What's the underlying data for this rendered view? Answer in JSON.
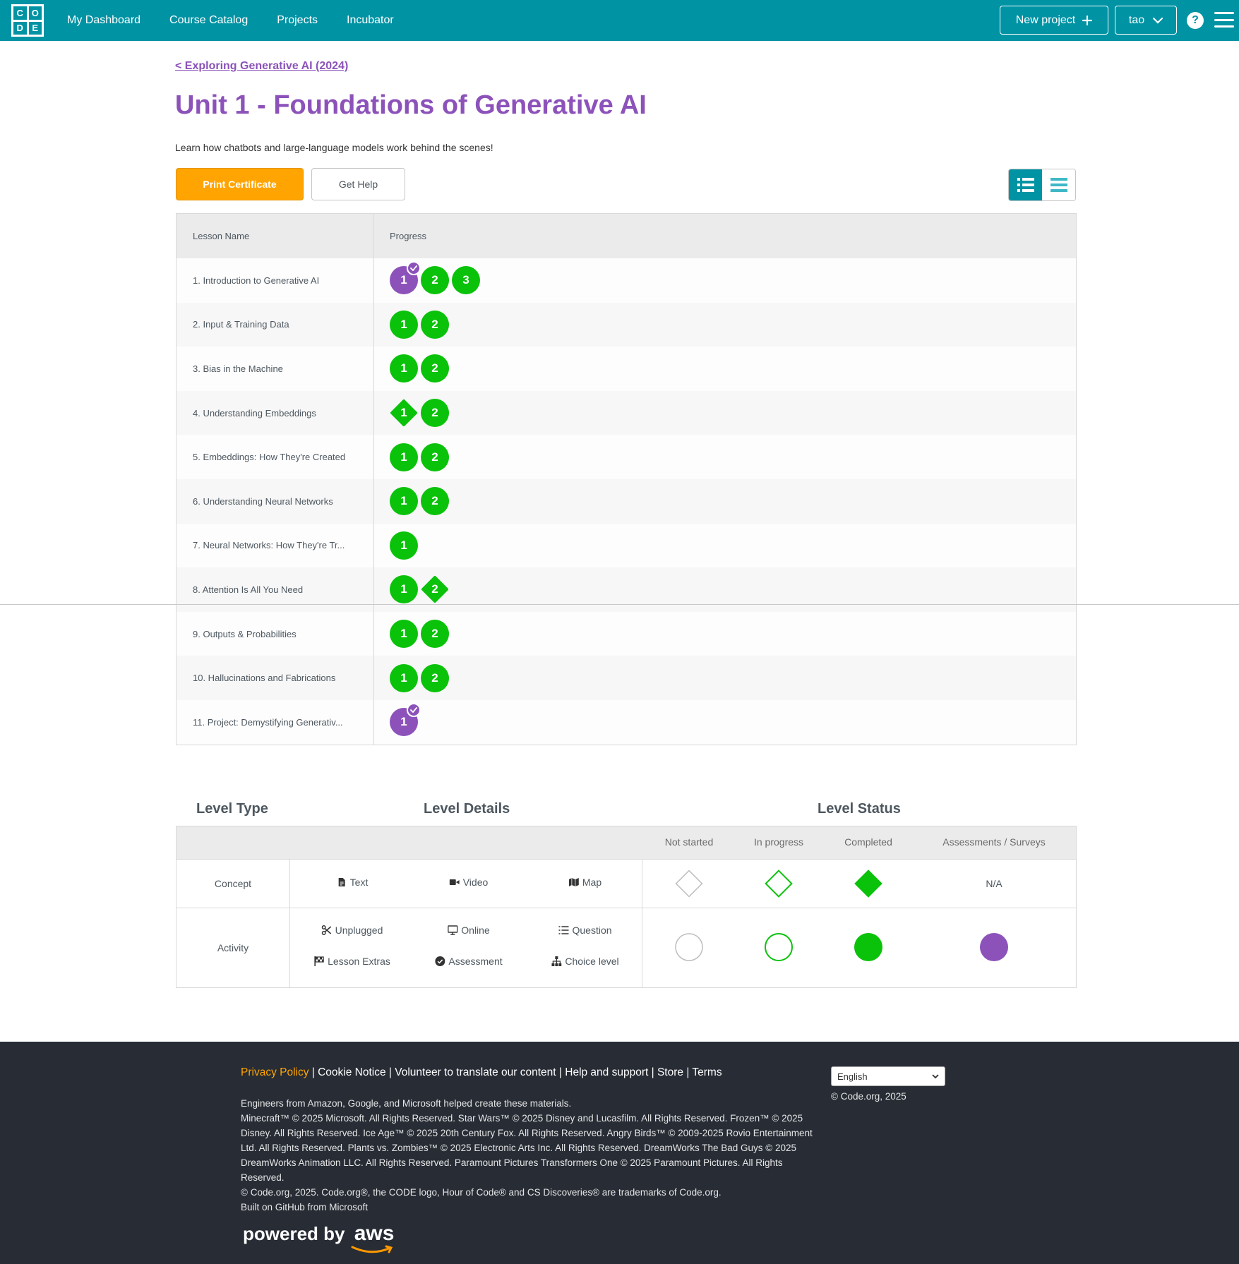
{
  "header": {
    "logo_letters": [
      "C",
      "O",
      "D",
      "E"
    ],
    "nav": [
      "My Dashboard",
      "Course Catalog",
      "Projects",
      "Incubator"
    ],
    "new_project": "New project",
    "user": "tao",
    "help_glyph": "?"
  },
  "page": {
    "breadcrumb": "< Exploring Generative AI (2024)",
    "title": "Unit 1 - Foundations of Generative AI",
    "description": "Learn how chatbots and large-language models work behind the scenes!",
    "print_certificate": "Print Certificate",
    "get_help": "Get Help"
  },
  "lessons": {
    "columns": [
      "Lesson Name",
      "Progress"
    ],
    "rows": [
      {
        "name": "1. Introduction to Generative AI",
        "levels": [
          {
            "n": "1",
            "type": "circle",
            "status": "assessment-completed"
          },
          {
            "n": "2",
            "type": "circle",
            "status": "completed"
          },
          {
            "n": "3",
            "type": "circle",
            "status": "completed"
          }
        ]
      },
      {
        "name": "2. Input & Training Data",
        "levels": [
          {
            "n": "1",
            "type": "circle",
            "status": "completed"
          },
          {
            "n": "2",
            "type": "circle",
            "status": "completed"
          }
        ]
      },
      {
        "name": "3. Bias in the Machine",
        "levels": [
          {
            "n": "1",
            "type": "circle",
            "status": "completed"
          },
          {
            "n": "2",
            "type": "circle",
            "status": "completed"
          }
        ]
      },
      {
        "name": "4. Understanding Embeddings",
        "levels": [
          {
            "n": "1",
            "type": "diamond",
            "status": "completed"
          },
          {
            "n": "2",
            "type": "circle",
            "status": "completed"
          }
        ]
      },
      {
        "name": "5. Embeddings: How They're Created",
        "levels": [
          {
            "n": "1",
            "type": "circle",
            "status": "completed"
          },
          {
            "n": "2",
            "type": "circle",
            "status": "completed"
          }
        ]
      },
      {
        "name": "6. Understanding Neural Networks",
        "levels": [
          {
            "n": "1",
            "type": "circle",
            "status": "completed"
          },
          {
            "n": "2",
            "type": "circle",
            "status": "completed"
          }
        ]
      },
      {
        "name": "7. Neural Networks: How They're Tr...",
        "levels": [
          {
            "n": "1",
            "type": "circle",
            "status": "completed"
          }
        ]
      },
      {
        "name": "8. Attention Is All You Need",
        "levels": [
          {
            "n": "1",
            "type": "circle",
            "status": "completed"
          },
          {
            "n": "2",
            "type": "diamond",
            "status": "completed"
          }
        ]
      },
      {
        "name": "9. Outputs & Probabilities",
        "levels": [
          {
            "n": "1",
            "type": "circle",
            "status": "completed"
          },
          {
            "n": "2",
            "type": "circle",
            "status": "completed"
          }
        ]
      },
      {
        "name": "10. Hallucinations and Fabrications",
        "levels": [
          {
            "n": "1",
            "type": "circle",
            "status": "completed"
          },
          {
            "n": "2",
            "type": "circle",
            "status": "completed"
          }
        ]
      },
      {
        "name": "11. Project: Demystifying Generativ...",
        "levels": [
          {
            "n": "1",
            "type": "circle",
            "status": "assessment-completed"
          }
        ]
      }
    ]
  },
  "key": {
    "level_type": "Level Type",
    "level_details": "Level Details",
    "level_status": "Level Status",
    "status_columns": [
      "Not started",
      "In progress",
      "Completed",
      "Assessments / Surveys"
    ],
    "concept": {
      "label": "Concept",
      "items": [
        "Text",
        "Video",
        "Map"
      ],
      "na": "N/A"
    },
    "activity": {
      "label": "Activity",
      "items": [
        "Unplugged",
        "Online",
        "Question",
        "Lesson Extras",
        "Assessment",
        "Choice level"
      ]
    }
  },
  "colors": {
    "brand_teal": "#0093a4",
    "purple": "#8c52ba",
    "green": "#0ac20a",
    "orange": "#ffa400",
    "footer_bg": "#272c35"
  },
  "footer": {
    "links": [
      "Privacy Policy",
      "Cookie Notice",
      "Volunteer to translate our content",
      "Help and support",
      "Store",
      "Terms"
    ],
    "language": "English",
    "copyright_short": "© Code.org, 2025",
    "lines": [
      "Engineers from Amazon, Google, and Microsoft helped create these materials.",
      "Minecraft™ © 2025 Microsoft. All Rights Reserved. Star Wars™ © 2025 Disney and Lucasfilm. All Rights Reserved. Frozen™ © 2025 Disney. All Rights Reserved. Ice Age™ © 2025 20th Century Fox. All Rights Reserved. Angry Birds™ © 2009-2025 Rovio Entertainment Ltd. All Rights Reserved. Plants vs. Zombies™ © 2025 Electronic Arts Inc. All Rights Reserved. DreamWorks The Bad Guys © 2025 DreamWorks Animation LLC. All Rights Reserved. Paramount Pictures Transformers One © 2025 Paramount Pictures. All Rights Reserved.",
      "© Code.org, 2025. Code.org®, the CODE logo, Hour of Code® and CS Discoveries® are trademarks of Code.org.",
      "Built on GitHub from Microsoft"
    ],
    "powered_by": "powered by",
    "aws": "aws"
  }
}
